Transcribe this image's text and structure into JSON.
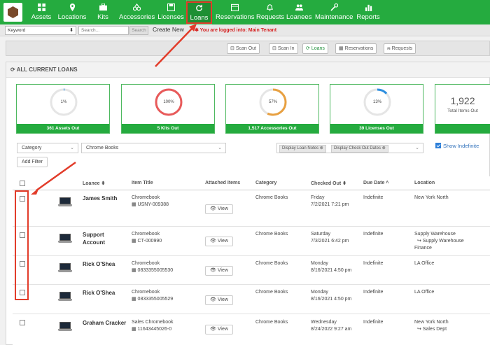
{
  "nav": {
    "items": [
      {
        "label": "Assets"
      },
      {
        "label": "Locations"
      },
      {
        "label": "Kits"
      },
      {
        "label": "Accessories"
      },
      {
        "label": "Licenses"
      },
      {
        "label": "Loans"
      },
      {
        "label": "Reservations"
      },
      {
        "label": "Requests"
      },
      {
        "label": "Loanees"
      },
      {
        "label": "Maintenance"
      },
      {
        "label": "Reports"
      }
    ],
    "active": "Loans"
  },
  "subbar": {
    "keyword_select": "Keyword",
    "search_placeholder": "Search...",
    "search_button": "Search",
    "create_new": "Create New",
    "login_message": "✱ You are logged into: Main Tenant"
  },
  "actions": {
    "scan_out": "Scan Out",
    "scan_in": "Scan In",
    "loans": "Loans",
    "reservations": "Reservations",
    "requests": "Requests"
  },
  "panel": {
    "title": "ALL CURRENT LOANS"
  },
  "stats": [
    {
      "pct_label": "1%",
      "pct": 1,
      "ring_color": "#2d8fe0",
      "caption": "361 Assets Out"
    },
    {
      "pct_label": "100%",
      "pct": 100,
      "ring_color": "#e85a5a",
      "caption": "5 Kits Out"
    },
    {
      "pct_label": "57%",
      "pct": 57,
      "ring_color": "#e8a040",
      "caption": "1,517 Accessories Out"
    },
    {
      "pct_label": "13%",
      "pct": 13,
      "ring_color": "#2d8fe0",
      "caption": "39 Licenses Out"
    },
    {
      "big": "1,922",
      "sub": "Total Items Out"
    }
  ],
  "filters": {
    "category": "Category",
    "category_value": "Chrome Books",
    "chip1": "Display Loan Notes ⊗",
    "chip2": "Display Check Out Dates ⊗",
    "show_indefinite": "Show Indefinite",
    "add_filter": "Add Filter"
  },
  "table": {
    "headers": {
      "loanee": "Loanee ⬍",
      "item_title": "Item Title",
      "attached": "Attached Items",
      "category": "Category",
      "checked_out": "Checked Out ⬍",
      "due_date": "Due Date ˄",
      "location": "Location"
    },
    "view_label": "👁 View",
    "rows": [
      {
        "loanee": "James Smith",
        "loanee2": "",
        "item": "Chromebook",
        "item_id": "▦ USNY-009388",
        "category": "Chrome Books",
        "day": "Friday",
        "datetime": "7/2/2021 7:21 pm",
        "due": "Indefinite",
        "loc1": "New York North",
        "loc2": "",
        "loc3": ""
      },
      {
        "loanee": "Support",
        "loanee2": "Account",
        "item": "Chromebook",
        "item_id": "▦ CT-000990",
        "category": "Chrome Books",
        "day": "Saturday",
        "datetime": "7/3/2021 6:42 pm",
        "due": "Indefinite",
        "loc1": "Supply Warehouse",
        "loc2": "↪ Supply Warehouse",
        "loc3": "Finance"
      },
      {
        "loanee": "Rick O'Shea",
        "loanee2": "",
        "item": "Chromebook",
        "item_id": "▦ 0833355005530",
        "category": "Chrome Books",
        "day": "Monday",
        "datetime": "8/16/2021 4:50 pm",
        "due": "Indefinite",
        "loc1": "LA Office",
        "loc2": "",
        "loc3": ""
      },
      {
        "loanee": "Rick O'Shea",
        "loanee2": "",
        "item": "Chromebook",
        "item_id": "▦ 0833355005529",
        "category": "Chrome Books",
        "day": "Monday",
        "datetime": "8/16/2021 4:50 pm",
        "due": "Indefinite",
        "loc1": "LA Office",
        "loc2": "",
        "loc3": ""
      },
      {
        "loanee": "Graham Cracker",
        "loanee2": "",
        "item": "Sales Chromebook",
        "item_id": "▦ 11643445026-0",
        "category": "Chrome Books",
        "day": "Wednesday",
        "datetime": "8/24/2022 9:27 am",
        "due": "Indefinite",
        "loc1": "New York North",
        "loc2": "↪ Sales Dept",
        "loc3": ""
      }
    ]
  }
}
